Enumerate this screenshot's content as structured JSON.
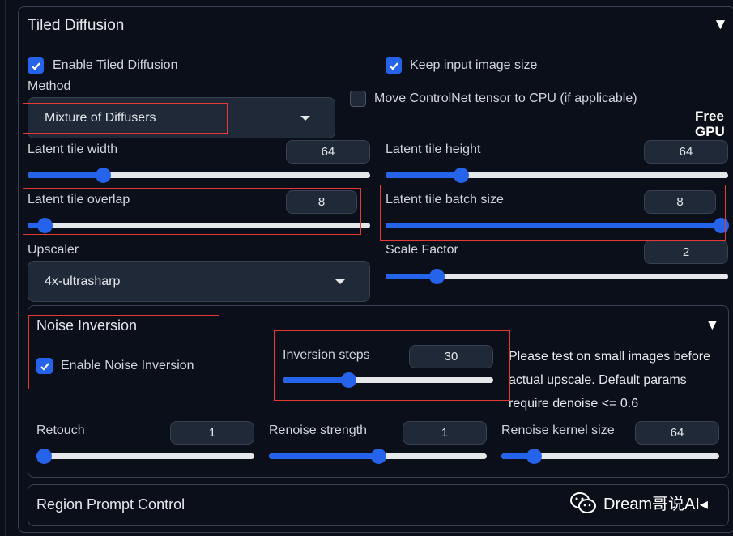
{
  "panel": {
    "title": "Tiled Diffusion"
  },
  "enable_tiled": {
    "label": "Enable Tiled Diffusion",
    "checked": true
  },
  "keep_size": {
    "label": "Keep input image size",
    "checked": true
  },
  "method": {
    "label": "Method",
    "value": "Mixture of Diffusers"
  },
  "move_controlnet": {
    "label": "Move ControlNet tensor to CPU (if applicable)",
    "checked": false
  },
  "free_gpu": {
    "line1": "Free",
    "line2": "GPU"
  },
  "latent_tile_width": {
    "label": "Latent tile width",
    "value": "64",
    "fraction": 0.22
  },
  "latent_tile_height": {
    "label": "Latent tile height",
    "value": "64",
    "fraction": 0.22
  },
  "latent_tile_overlap": {
    "label": "Latent tile overlap",
    "value": "8",
    "fraction": 0.05
  },
  "latent_tile_batch": {
    "label": "Latent tile batch size",
    "value": "8",
    "fraction": 1.0
  },
  "upscaler": {
    "label": "Upscaler",
    "value": "4x-ultrasharp"
  },
  "scale_factor": {
    "label": "Scale Factor",
    "value": "2",
    "fraction": 0.15
  },
  "noise_inversion": {
    "title": "Noise Inversion",
    "enable": {
      "label": "Enable Noise Inversion",
      "checked": true
    },
    "steps": {
      "label": "Inversion steps",
      "value": "30",
      "fraction": 0.31
    },
    "note_lines": [
      "Please test on small images before",
      "actual upscale. Default params",
      "require denoise <= 0.6"
    ],
    "retouch": {
      "label": "Retouch",
      "value": "1",
      "fraction": 0.0
    },
    "renoise_strength": {
      "label": "Renoise strength",
      "value": "1",
      "fraction": 0.5
    },
    "renoise_kernel": {
      "label": "Renoise kernel size",
      "value": "64",
      "fraction": 0.15
    }
  },
  "region_prompt": {
    "title": "Region Prompt Control"
  },
  "watermark": {
    "text": "Dream哥说AI◂"
  }
}
